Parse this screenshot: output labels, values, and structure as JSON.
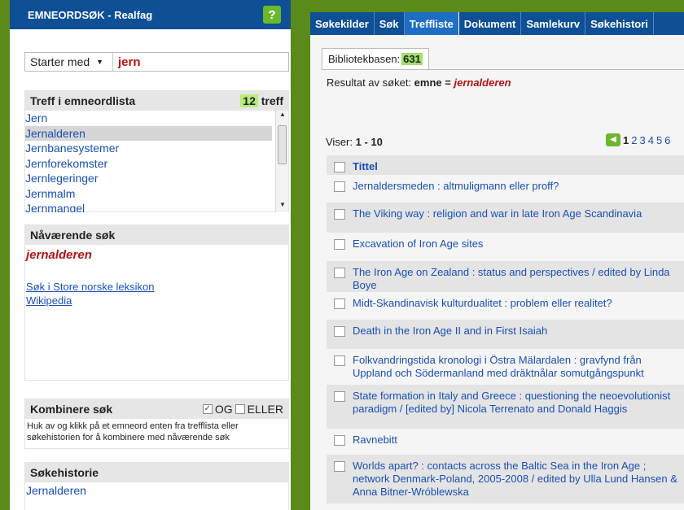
{
  "left": {
    "header_title": "EMNEORDSØK - Realfag",
    "help_label": "?",
    "search": {
      "mode": "Starter med",
      "term": "jern"
    },
    "treff": {
      "title": "Treff i emneordlista",
      "count": "12",
      "count_suffix": "treff",
      "items": [
        "Jern",
        "Jernalderen",
        "Jernbanesystemer",
        "Jernforekomster",
        "Jernlegeringer",
        "Jernmalm",
        "Jernmangel"
      ],
      "selected_index": 1
    },
    "navaerende": {
      "title": "Nåværende søk",
      "term": "jernalderen",
      "links": [
        "Søk i Store norske leksikon",
        "Wikipedia"
      ]
    },
    "kombinere": {
      "title": "Kombinere søk",
      "og_label": "OG",
      "eller_label": "ELLER",
      "og_checked": true,
      "eller_checked": false,
      "help": "Huk av og klikk på et emneord enten fra trefflista eller søkehistorien for å kombinere med nåværende søk"
    },
    "sokehistorie": {
      "title": "Søkehistorie",
      "items": [
        "Jernalderen"
      ]
    }
  },
  "right": {
    "tabs": [
      "Søkekilder",
      "Søk",
      "Treffliste",
      "Dokument",
      "Samlekurv",
      "Søkehistori"
    ],
    "active_tab": 2,
    "bibl_label": "Bibliotekbasen:",
    "bibl_count": "631",
    "resultat_prefix": "Resultat av søket:",
    "resultat_field": "emne",
    "resultat_eq": "=",
    "resultat_value": "jernalderen",
    "viser_label": "Viser:",
    "viser_range": "1 - 10",
    "pages": [
      "1",
      "2",
      "3",
      "4",
      "5",
      "6"
    ],
    "current_page": "1",
    "column_header": "Tittel",
    "results": [
      "Jernaldersmeden : altmuligmann eller proff?",
      "The Viking way : religion and war in late Iron Age Scandinavia",
      "Excavation of Iron Age sites",
      "The Iron Age on Zealand : status and perspectives / edited by Linda Boye",
      "Midt-Skandinavisk kulturdualitet : problem eller realitet?",
      "Death in the Iron Age II and in First Isaiah",
      "Folkvandringstida kronologi i Östra Mälardalen : gravfynd från Uppland och Södermanland med dräktnålar somutgångspunkt",
      "State formation in Italy and Greece : questioning the neoevolutionist paradigm / [edited by] Nicola Terrenato and Donald Haggis",
      "Ravnebitt",
      "Worlds apart? : contacts across the Baltic Sea in the Iron Age ; network Denmark-Poland, 2005-2008 / edited by Ulla Lund Hansen & Anna Bitner-Wróblewska"
    ]
  }
}
